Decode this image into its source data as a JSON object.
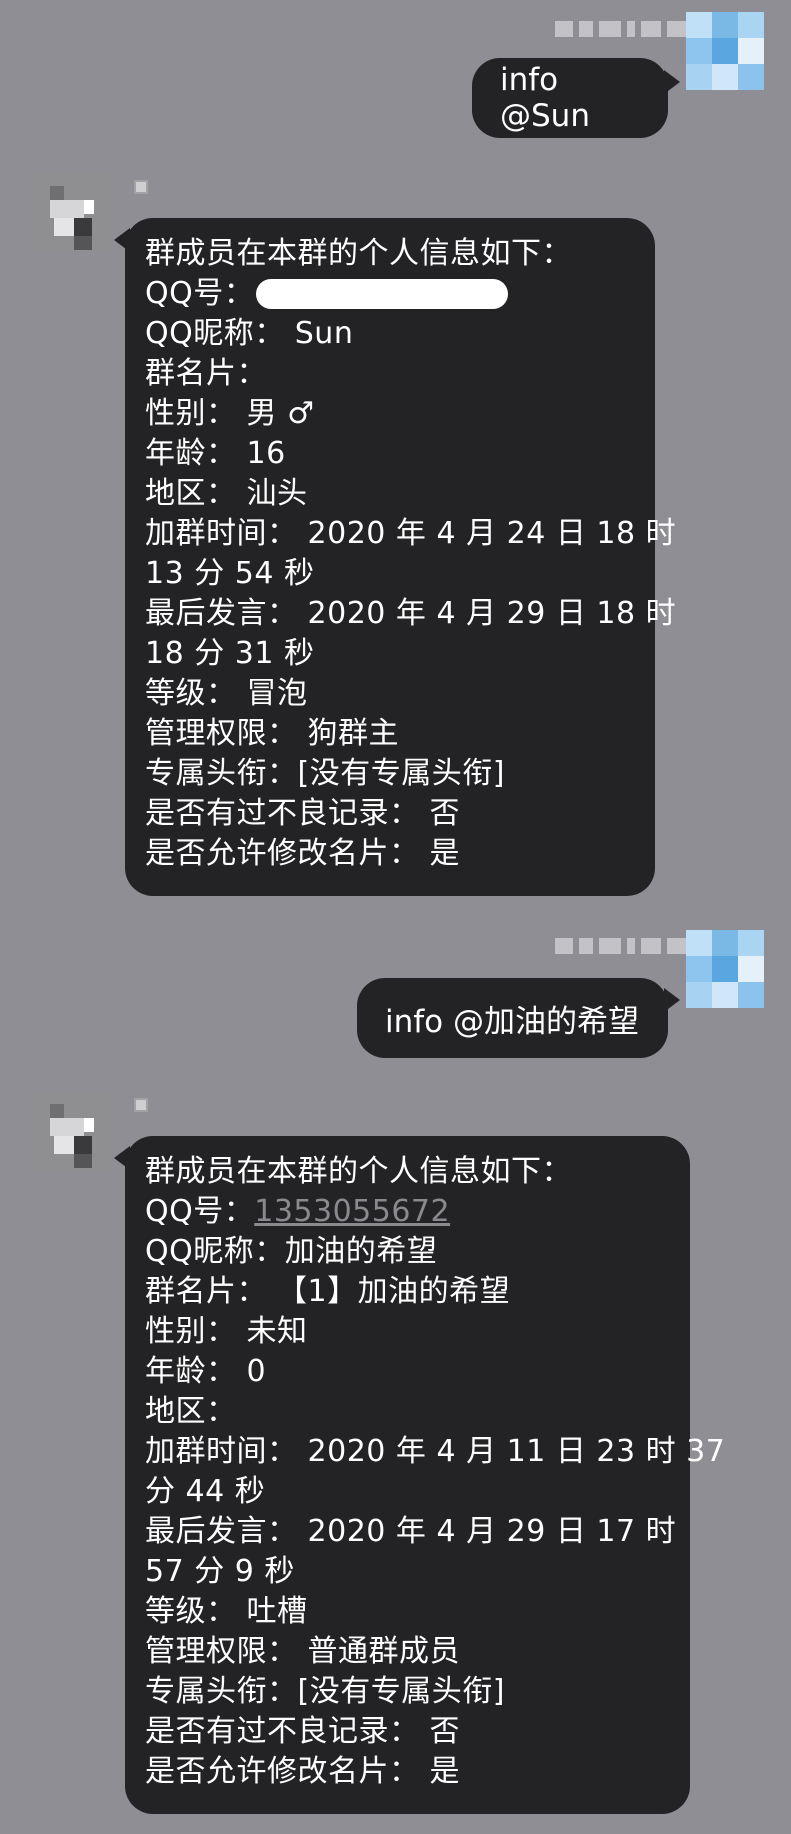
{
  "colors": {
    "background": "#8e8e94",
    "bubble": "#232325",
    "text": "#ffffff",
    "link": "#8a8a8e"
  },
  "messages": [
    {
      "direction": "outgoing",
      "text": "info @Sun"
    },
    {
      "direction": "incoming",
      "lines": [
        "群成员在本群的个人信息如下：",
        "QQ号：",
        "QQ昵称：  Sun",
        "群名片：",
        "性别：  男 ♂",
        "年龄：  16",
        "地区：  汕头",
        "加群时间：  2020 年 4 月 24 日 18 时",
        "13 分 54 秒",
        "最后发言：  2020 年 4 月 29 日 18 时",
        "18 分 31 秒",
        "等级：  冒泡",
        "管理权限：  狗群主",
        "专属头衔：[没有专属头衔]",
        "是否有过不良记录：  否",
        "是否允许修改名片：  是"
      ]
    },
    {
      "direction": "outgoing",
      "text": "info @加油的希望"
    },
    {
      "direction": "incoming",
      "qq_label": "QQ号：",
      "qq_number": "1353055672",
      "lines": [
        "群成员在本群的个人信息如下：",
        "QQ昵称：加油的希望",
        "群名片：  【1】加油的希望",
        "性别：  未知",
        "年龄：  0",
        "地区：",
        "加群时间：  2020 年 4 月 11 日 23 时 37",
        "分 44 秒",
        "最后发言：  2020 年 4 月 29 日 17 时",
        "57 分 9 秒",
        "等级：  吐槽",
        "管理权限：  普通群成员",
        "专属头衔：[没有专属头衔]",
        "是否有过不良记录：  否",
        "是否允许修改名片：  是"
      ]
    }
  ]
}
